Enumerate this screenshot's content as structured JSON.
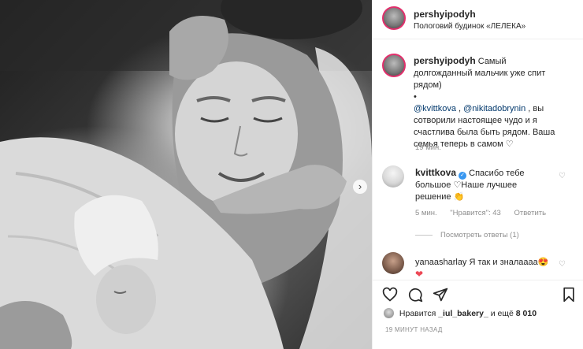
{
  "colors": {
    "accent": "#e1306c",
    "link": "#00376b",
    "muted": "#8e8e8e",
    "heart": "#ed4956",
    "divider": "#efefef"
  },
  "header": {
    "username": "pershyipodyh",
    "location": "Пологовий будинок «ЛЕЛЕКА»",
    "more_icon": "more-horizontal-icon"
  },
  "caption": {
    "username": "pershyipodyh",
    "text_start": "Самый долгожданный мальчик уже спит рядом)",
    "bullet": "•",
    "mention1": "@kvittkova",
    "sep": " , ",
    "mention2": "@nikitadobrynin",
    "text_end": " , вы сотворили настоящее чудо и я счастлива была быть рядом. Ваша семья теперь в самом",
    "emoji": "♡",
    "time": "19 мин."
  },
  "comments": [
    {
      "username": "kvittkova",
      "verified": "verified-badge-icon",
      "text": "Спасибо тебе большое ♡Наше лучшее решение",
      "emoji": "👏",
      "time": "5 мин.",
      "likes": "\"Нравится\": 43",
      "reply": "Ответить",
      "view_replies": "Посмотреть ответы (1)"
    },
    {
      "username": "yanaasharlay",
      "text": "Я так и знала",
      "text2": "ааа",
      "emoji": "😍",
      "heart": "❤"
    }
  ],
  "actions": {
    "like_icon": "heart-icon",
    "comment_icon": "comment-icon",
    "share_icon": "send-icon",
    "save_icon": "bookmark-icon"
  },
  "likes": {
    "prefix": "Нравится",
    "user": "_iul_bakery_",
    "suffix": "и ещё",
    "count": "8 010"
  },
  "timestamp": "19 МИНУТ НАЗАД",
  "photo": {
    "alt": "black-and-white-newborn-photo",
    "next_icon": "chevron-right-icon",
    "next_glyph": "›"
  }
}
